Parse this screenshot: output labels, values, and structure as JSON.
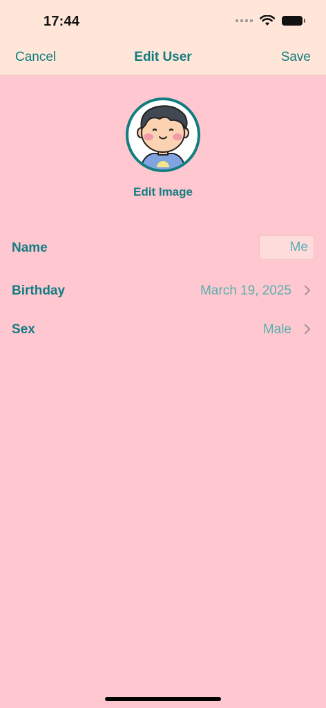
{
  "status": {
    "time": "17:44"
  },
  "nav": {
    "cancel": "Cancel",
    "title": "Edit User",
    "save": "Save"
  },
  "avatar": {
    "edit_label": "Edit Image"
  },
  "form": {
    "name": {
      "label": "Name",
      "value": "Me"
    },
    "birthday": {
      "label": "Birthday",
      "value": "March 19, 2025"
    },
    "sex": {
      "label": "Sex",
      "value": "Male"
    }
  },
  "colors": {
    "background": "#FFC8D0",
    "header": "#FFE6D8",
    "accent": "#107D7E",
    "value": "#5AAFAF"
  }
}
